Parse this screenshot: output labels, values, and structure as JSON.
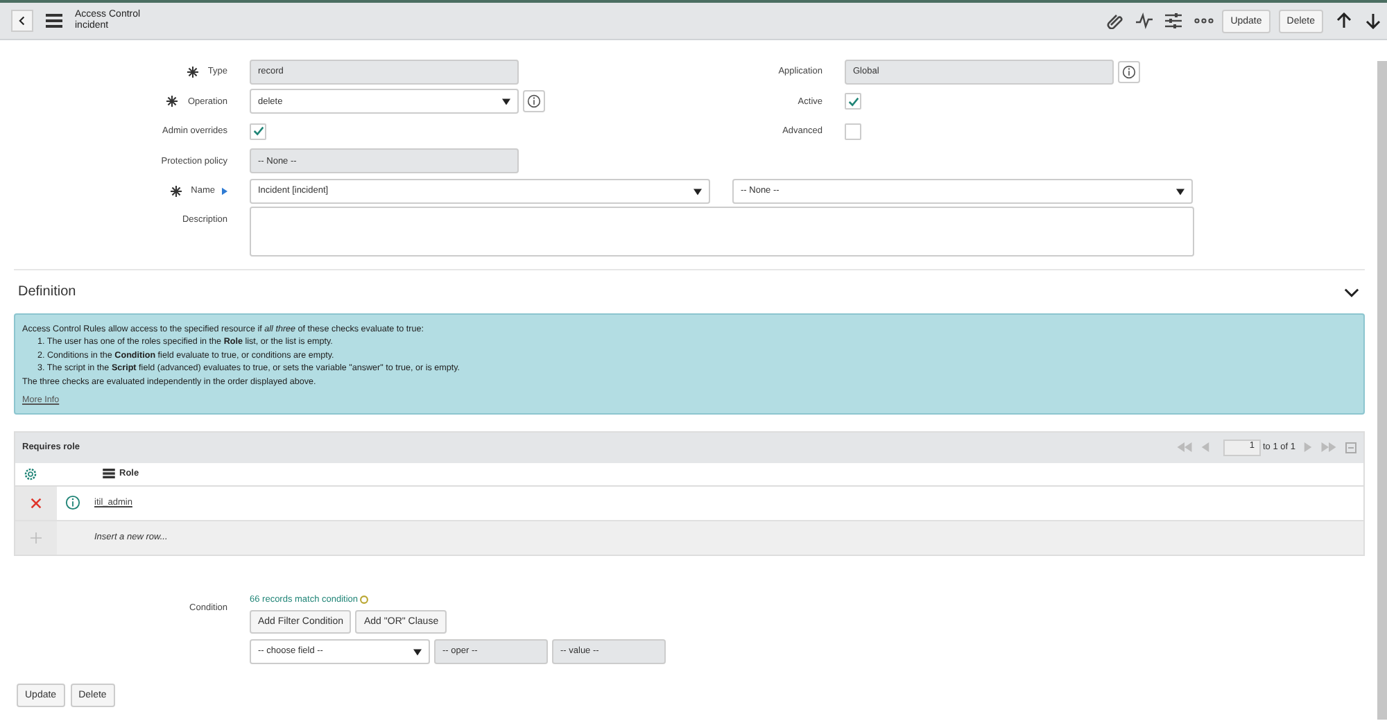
{
  "header": {
    "title": "Access Control",
    "subtitle": "incident",
    "buttons": [
      "Update",
      "Delete"
    ]
  },
  "form_left": [
    {
      "kind": "readonly",
      "label": "Type",
      "required": true,
      "value": "record"
    },
    {
      "kind": "select",
      "label": "Operation",
      "required": true,
      "value": "delete",
      "info": true
    },
    {
      "kind": "checkbox",
      "label": "Admin overrides",
      "checked": true
    },
    {
      "kind": "readonly",
      "label": "Protection policy",
      "value": "-- None --"
    }
  ],
  "form_right": [
    {
      "kind": "readonly",
      "label": "Application",
      "value": "Global",
      "info": true
    },
    {
      "kind": "checkbox",
      "label": "Active",
      "checked": true
    },
    {
      "kind": "checkbox",
      "label": "Advanced",
      "checked": false
    }
  ],
  "name_field": {
    "label": "Name",
    "required": true,
    "value": "Incident [incident]",
    "second_value": "-- None --"
  },
  "description": {
    "label": "Description"
  },
  "definition": {
    "title": "Definition",
    "expanded": true,
    "intro": "Access Control Rules allow access to the specified resource if *all three* of these checks evaluate to true:",
    "items": [
      "1. The user has one of the roles specified in the **Role** list, or the list is empty.",
      "2. Conditions in the **Condition** field evaluate to true, or conditions are empty.",
      "3. The script in the **Script** field (advanced) evaluates to true, or sets the variable \"answer\" to true, or is empty."
    ],
    "note": "The three checks are evaluated independently in the order displayed above.",
    "link": "More Info"
  },
  "related_list": {
    "title": "Requires role",
    "page": "1",
    "range": "to 1 of 1",
    "column": "Role",
    "rows": [
      "itil_admin"
    ],
    "insert_row": "Insert a new row..."
  },
  "condition": {
    "label": "Condition",
    "match": "66 records match condition",
    "buttons": [
      "Add Filter Condition",
      "Add \"OR\" Clause"
    ],
    "field": "-- choose field --",
    "oper": "-- oper --",
    "value": "-- value --"
  },
  "footer_buttons": [
    "Update",
    "Delete"
  ]
}
